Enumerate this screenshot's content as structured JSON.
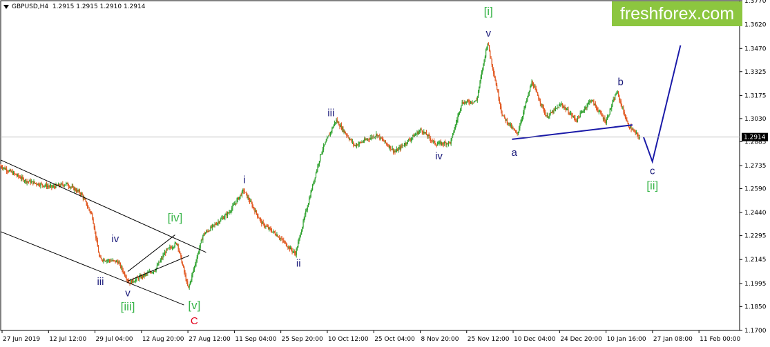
{
  "header": {
    "symbol_line": "GBPUSD,H4  1.2915 1.2915 1.2910 1.2914"
  },
  "logo": {
    "text": "freshforex.com",
    "bg_color": "#8cc63f"
  },
  "colors": {
    "bull": "#2ca02c",
    "bear": "#e0531a",
    "projection": "#1a1aa8",
    "channel": "#000000",
    "wave_blue": "#1a1a7a",
    "wave_green": "#39b54a",
    "wave_red": "#e2001a"
  },
  "chart_data": {
    "type": "candlestick",
    "title": "",
    "ylim": [
      1.17,
      1.377
    ],
    "y_ticks": [
      "1.3770",
      "1.3620",
      "1.3470",
      "1.3325",
      "1.3175",
      "1.3030",
      "1.2885",
      "1.2735",
      "1.2590",
      "1.2440",
      "1.2295",
      "1.2145",
      "1.1995",
      "1.1850",
      "1.1700"
    ],
    "x_ticks": [
      "27 Jun 2019",
      "12 Jul 12:00",
      "29 Jul 04:00",
      "12 Aug 20:00",
      "27 Aug 12:00",
      "11 Sep 04:00",
      "25 Sep 20:00",
      "10 Oct 12:00",
      "25 Oct 04:00",
      "8 Nov 20:00",
      "25 Nov 12:00",
      "10 Dec 04:00",
      "24 Dec 20:00",
      "10 Jan 16:00",
      "27 Jan 08:00",
      "11 Feb 00:00"
    ],
    "current_price": "1.2914",
    "price_path": [
      [
        0,
        1.2735
      ],
      [
        0.035,
        1.264
      ],
      [
        0.07,
        1.26
      ],
      [
        0.09,
        1.262
      ],
      [
        0.11,
        1.256
      ],
      [
        0.125,
        1.242
      ],
      [
        0.135,
        1.215
      ],
      [
        0.16,
        1.213
      ],
      [
        0.175,
        1.2
      ],
      [
        0.21,
        1.208
      ],
      [
        0.225,
        1.22
      ],
      [
        0.24,
        1.225
      ],
      [
        0.255,
        1.196
      ],
      [
        0.275,
        1.23
      ],
      [
        0.31,
        1.244
      ],
      [
        0.33,
        1.258
      ],
      [
        0.355,
        1.237
      ],
      [
        0.375,
        1.23
      ],
      [
        0.4,
        1.218
      ],
      [
        0.415,
        1.246
      ],
      [
        0.435,
        1.282
      ],
      [
        0.455,
        1.302
      ],
      [
        0.48,
        1.286
      ],
      [
        0.51,
        1.293
      ],
      [
        0.535,
        1.282
      ],
      [
        0.57,
        1.296
      ],
      [
        0.59,
        1.287
      ],
      [
        0.61,
        1.288
      ],
      [
        0.625,
        1.313
      ],
      [
        0.645,
        1.314
      ],
      [
        0.66,
        1.351
      ],
      [
        0.68,
        1.305
      ],
      [
        0.7,
        1.293
      ],
      [
        0.72,
        1.326
      ],
      [
        0.74,
        1.304
      ],
      [
        0.76,
        1.312
      ],
      [
        0.78,
        1.302
      ],
      [
        0.8,
        1.315
      ],
      [
        0.82,
        1.301
      ],
      [
        0.835,
        1.32
      ],
      [
        0.85,
        1.299
      ],
      [
        0.865,
        1.2914
      ]
    ],
    "projection": [
      [
        0.87,
        1.2914
      ],
      [
        0.882,
        1.276
      ],
      [
        0.92,
        1.349
      ]
    ],
    "wave_labels": [
      {
        "text": "[i]",
        "x": 0.66,
        "y": 1.368,
        "style": "green"
      },
      {
        "text": "v",
        "x": 0.66,
        "y": 1.3545,
        "style": "blue"
      },
      {
        "text": "iii",
        "x": 0.447,
        "y": 1.3045,
        "style": "blue"
      },
      {
        "text": "iv",
        "x": 0.593,
        "y": 1.2775,
        "style": "blue"
      },
      {
        "text": "a",
        "x": 0.695,
        "y": 1.2795,
        "style": "blue"
      },
      {
        "text": "b",
        "x": 0.839,
        "y": 1.324,
        "style": "blue"
      },
      {
        "text": "c",
        "x": 0.882,
        "y": 1.268,
        "style": "blue"
      },
      {
        "text": "[ii]",
        "x": 0.882,
        "y": 1.2585,
        "style": "green"
      },
      {
        "text": "i",
        "x": 0.33,
        "y": 1.2625,
        "style": "blue"
      },
      {
        "text": "ii",
        "x": 0.403,
        "y": 1.21,
        "style": "blue"
      },
      {
        "text": "iv",
        "x": 0.155,
        "y": 1.2255,
        "style": "blue"
      },
      {
        "text": "iii",
        "x": 0.135,
        "y": 1.1985,
        "style": "blue"
      },
      {
        "text": "v",
        "x": 0.172,
        "y": 1.1915,
        "style": "blue"
      },
      {
        "text": "[iii]",
        "x": 0.172,
        "y": 1.1825,
        "style": "green"
      },
      {
        "text": "[iv]",
        "x": 0.236,
        "y": 1.2385,
        "style": "green"
      },
      {
        "text": "[v]",
        "x": 0.262,
        "y": 1.1835,
        "style": "green"
      },
      {
        "text": "C",
        "x": 0.262,
        "y": 1.174,
        "style": "red"
      }
    ],
    "trend_lines": [
      {
        "name": "channel-upper",
        "from": [
          0.0,
          1.277
        ],
        "to": [
          0.278,
          1.219
        ]
      },
      {
        "name": "channel-lower",
        "from": [
          0.0,
          1.232
        ],
        "to": [
          0.248,
          1.186
        ]
      },
      {
        "name": "triangle-upper",
        "from": [
          0.172,
          1.207
        ],
        "to": [
          0.236,
          1.23
        ]
      },
      {
        "name": "triangle-lower",
        "from": [
          0.172,
          1.201
        ],
        "to": [
          0.255,
          1.217
        ]
      },
      {
        "name": "a-b-line",
        "from": [
          0.692,
          1.29
        ],
        "to": [
          0.855,
          1.299
        ]
      }
    ]
  }
}
